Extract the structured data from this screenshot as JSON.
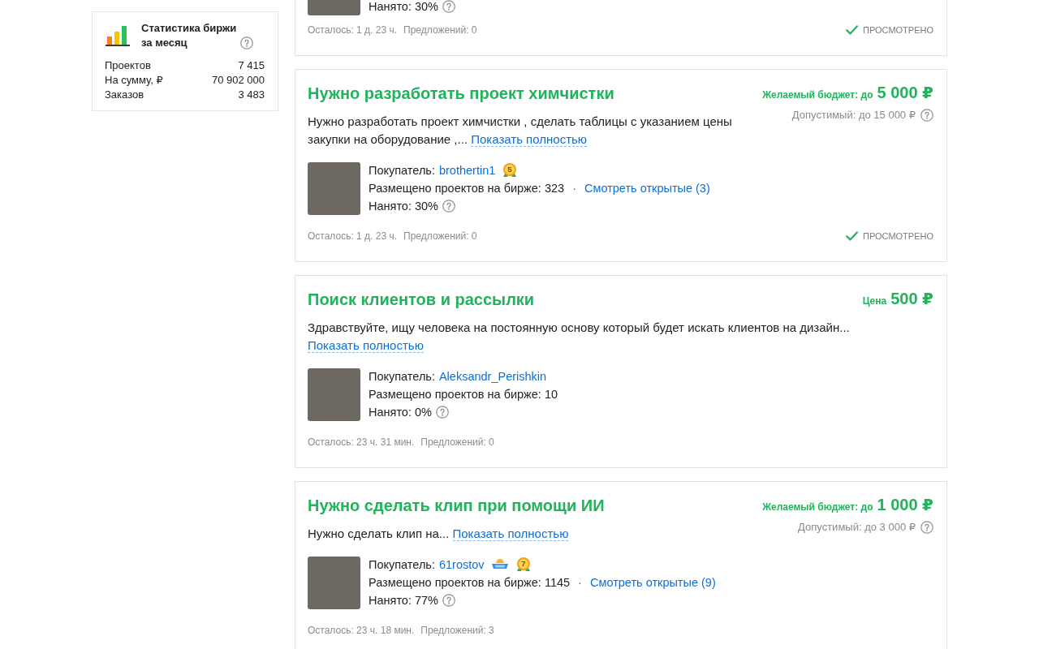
{
  "sidebar": {
    "stats": {
      "title": "Статистика биржи за месяц",
      "rows": [
        {
          "label": "Проектов",
          "value": "7 415"
        },
        {
          "label": "На сумму, ₽",
          "value": "70 902 000"
        },
        {
          "label": "Заказов",
          "value": "3 483"
        }
      ]
    }
  },
  "projects": [
    {
      "buyer": {
        "hired": "Нанято: 30%"
      },
      "time_left": "Осталось: 1 д. 23 ч.",
      "offers": "Предложений: 0",
      "viewed": true,
      "viewed_label": "ПРОСМОТРЕНО"
    },
    {
      "title": "Нужно разработать проект химчистки",
      "price": {
        "kind": "budget",
        "label": "Желаемый бюджет: до",
        "amount": "5 000 ₽",
        "max": "Допустимый: до 15 000 ₽"
      },
      "description": "Нужно разработать проект химчистки , сделать таблицы с указанием цены закупки на оборудование ,...",
      "more_link": "Показать полностью",
      "buyer": {
        "label": "Покупатель:",
        "name": "brothertin1",
        "badges": [
          {
            "kind": "medal",
            "label": "5"
          }
        ],
        "posted": "Размещено проектов на бирже: 323",
        "separator": "·",
        "open_link": "Смотреть открытые (3)",
        "hired": "Нанято: 30%"
      },
      "time_left": "Осталось: 1 д. 23 ч.",
      "offers": "Предложений: 0",
      "viewed": true,
      "viewed_label": "ПРОСМОТРЕНО"
    },
    {
      "title": "Поиск клиентов и рассылки",
      "price": {
        "kind": "fixed",
        "label": "Цена",
        "amount": "500 ₽"
      },
      "description": "Здравствуйте, ищу человека на постоянную основу который будет искать клиентов на дизайн...",
      "more_link": "Показать полностью",
      "buyer": {
        "label": "Покупатель:",
        "name": "Aleksandr_Perishkin",
        "posted": "Размещено проектов на бирже: 10",
        "hired": "Нанято: 0%"
      },
      "time_left": "Осталось: 23 ч. 31 мин.",
      "offers": "Предложений: 0",
      "viewed": false
    },
    {
      "title": "Нужно сделать клип при помощи ИИ",
      "price": {
        "kind": "budget",
        "label": "Желаемый бюджет: до",
        "amount": "1 000 ₽",
        "max": "Допустимый: до 3 000 ₽"
      },
      "description": "Нужно сделать клип на...",
      "more_link": "Показать полностью",
      "buyer": {
        "label": "Покупатель:",
        "name": "61rostov",
        "badges": [
          {
            "kind": "ribbon"
          },
          {
            "kind": "medal",
            "label": "7"
          }
        ],
        "posted": "Размещено проектов на бирже: 1145",
        "separator": "·",
        "open_link": "Смотреть открытые (9)",
        "hired": "Нанято: 77%"
      },
      "time_left": "Осталось: 23 ч. 18 мин.",
      "offers": "Предложений: 3",
      "viewed": false
    }
  ]
}
